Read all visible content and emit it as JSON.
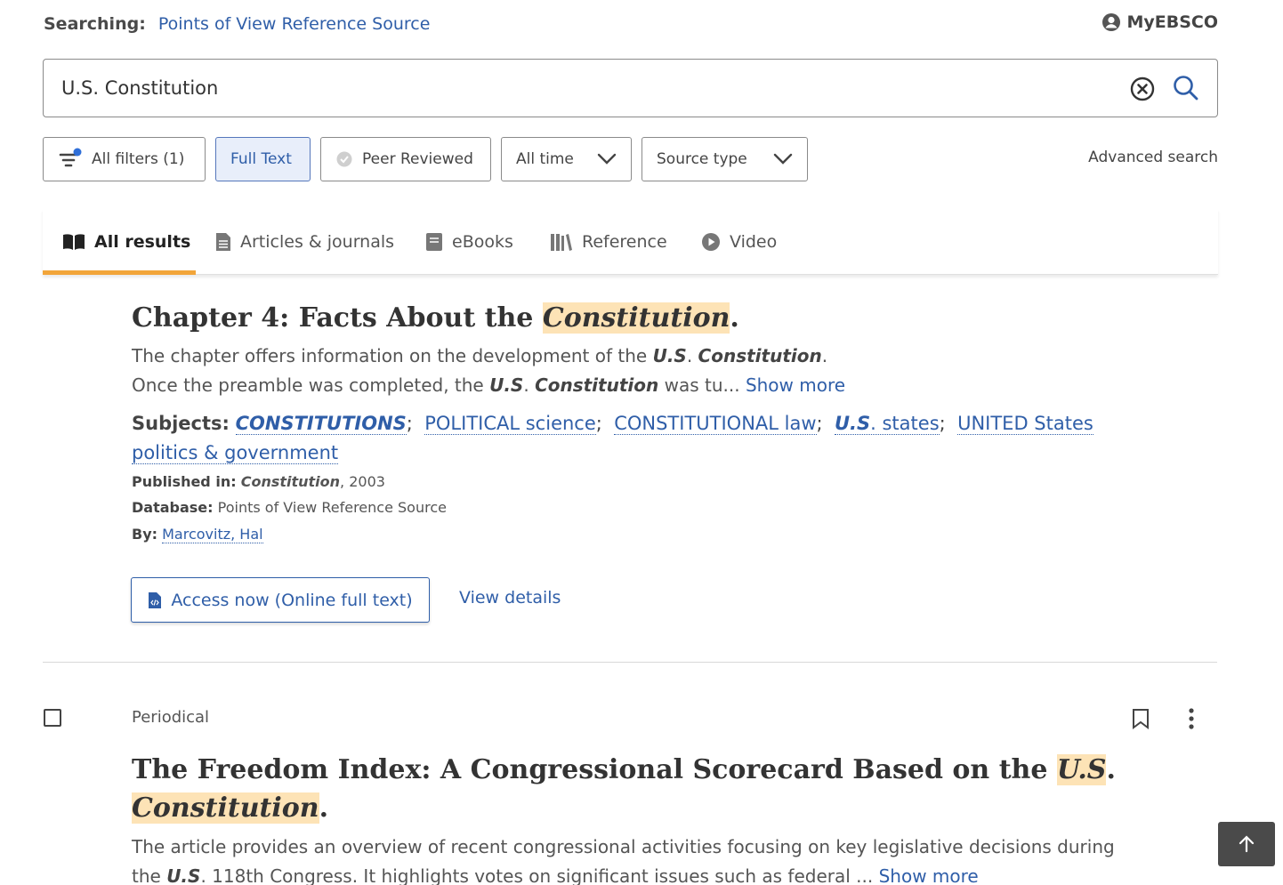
{
  "header": {
    "searching_label": "Searching:",
    "searching_source": "Points of View Reference Source",
    "account_label": "MyEBSCO"
  },
  "search": {
    "query": "U.S. Constitution",
    "clear_icon": "clear-icon",
    "search_icon": "search-icon"
  },
  "filters": {
    "all_filters": "All filters (1)",
    "full_text": "Full Text",
    "peer_reviewed": "Peer Reviewed",
    "date": "All time",
    "source_type": "Source type",
    "advanced": "Advanced search"
  },
  "tabs": [
    {
      "label": "All results",
      "icon": "open-book-icon",
      "active": true
    },
    {
      "label": "Articles & journals",
      "icon": "document-icon"
    },
    {
      "label": "eBooks",
      "icon": "ebook-icon"
    },
    {
      "label": "Reference",
      "icon": "library-icon"
    },
    {
      "label": "Video",
      "icon": "play-icon"
    }
  ],
  "result1": {
    "title_pre": "Chapter 4: Facts About the ",
    "title_hl": "Constitution",
    "title_post": ".",
    "abstract_1a": "The chapter offers information on the development of the ",
    "abstract_1b": "U.S",
    "abstract_1c": ". ",
    "abstract_1d": "Constitution",
    "abstract_1e": ".",
    "abstract_2a": "Once the preamble was completed, the ",
    "abstract_2b": "U.S",
    "abstract_2c": ". ",
    "abstract_2d": "Constitution",
    "abstract_2e": " was tu... ",
    "show_more": "Show more",
    "subjects_label": "Subjects:",
    "subjects": [
      "CONSTITUTIONS",
      "POLITICAL science",
      "CONSTITUTIONAL law",
      "U.S",
      ". states",
      "UNITED States politics & government"
    ],
    "published_label": "Published in:",
    "published_source": "Constitution",
    "published_year": ", 2003",
    "database_label": "Database:",
    "database_value": "Points of View Reference Source",
    "by_label": "By:",
    "author": "Marcovitz, Hal",
    "access_button": "Access now (Online full text)",
    "view_details": "View details"
  },
  "result2": {
    "type": "Periodical",
    "title_pre": "The Freedom Index: A Congressional Scorecard Based on the ",
    "title_hl1": "U.S",
    "title_mid": ".",
    "title_hl2": "Constitution",
    "title_post": ".",
    "abstract_1": "The article provides an overview of recent congressional activities focusing on key legislative decisions during",
    "abstract_2a": "the ",
    "abstract_2b": "U.S",
    "abstract_2c": ". 118th Congress. It highlights votes on significant issues such as federal ... ",
    "show_more": "Show more"
  },
  "colors": {
    "link": "#2f5ea8",
    "highlight": "#fde3b6",
    "tab_underline": "#f2a53a",
    "active_filter_bg": "#e8eefa"
  }
}
